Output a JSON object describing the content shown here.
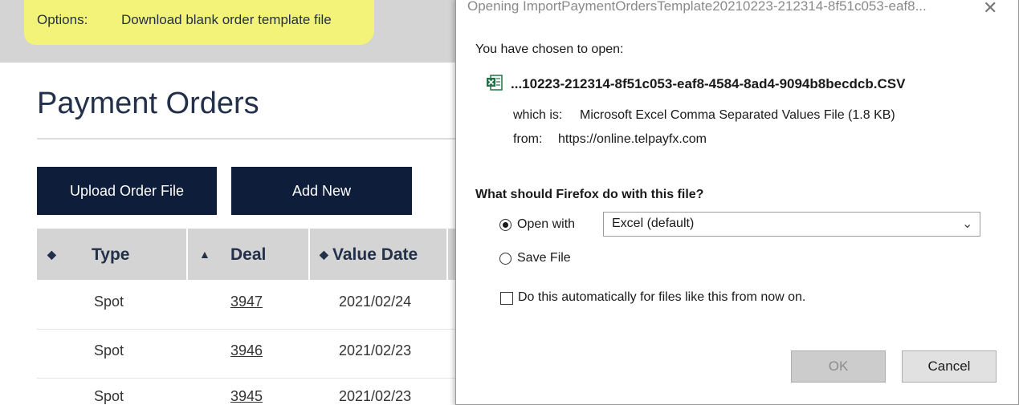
{
  "options_bar": {
    "label": "Options:",
    "download_link": "Download blank order template file"
  },
  "page": {
    "title": "Payment Orders",
    "upload_button": "Upload Order File",
    "add_button": "Add New"
  },
  "table": {
    "columns": [
      {
        "sort_icon": "◆",
        "label": "Type"
      },
      {
        "sort_icon": "▲",
        "label": "Deal"
      },
      {
        "sort_icon": "◆",
        "label": "Value Date"
      }
    ],
    "rows": [
      {
        "type": "Spot",
        "deal": "3947",
        "value_date": "2021/02/24"
      },
      {
        "type": "Spot",
        "deal": "3946",
        "value_date": "2021/02/23"
      },
      {
        "type": "Spot",
        "deal": "3945",
        "value_date": "2021/02/23"
      }
    ]
  },
  "dialog": {
    "title": "Opening ImportPaymentOrdersTemplate20210223-212314-8f51c053-eaf8...",
    "close_icon": "✕",
    "chosen_text": "You have chosen to open:",
    "file_icon": "excel-csv-icon",
    "file_name": "...10223-212314-8f51c053-eaf8-4584-8ad4-9094b8becdcb.CSV",
    "which_is_label": "which is:",
    "which_is_value": "Microsoft Excel Comma Separated Values File (1.8 KB)",
    "from_label": "from:",
    "from_value": "https://online.telpayfx.com",
    "question": "What should Firefox do with this file?",
    "open_with_label": "Open with",
    "open_with_value": "Excel (default)",
    "save_file_label": "Save File",
    "auto_label": "Do this automatically for files like this from now on.",
    "ok_label": "OK",
    "cancel_label": "Cancel"
  },
  "colors": {
    "navy": "#0d1d3a",
    "highlight": "#f3f37a",
    "header_gray": "#d4d4d4"
  }
}
